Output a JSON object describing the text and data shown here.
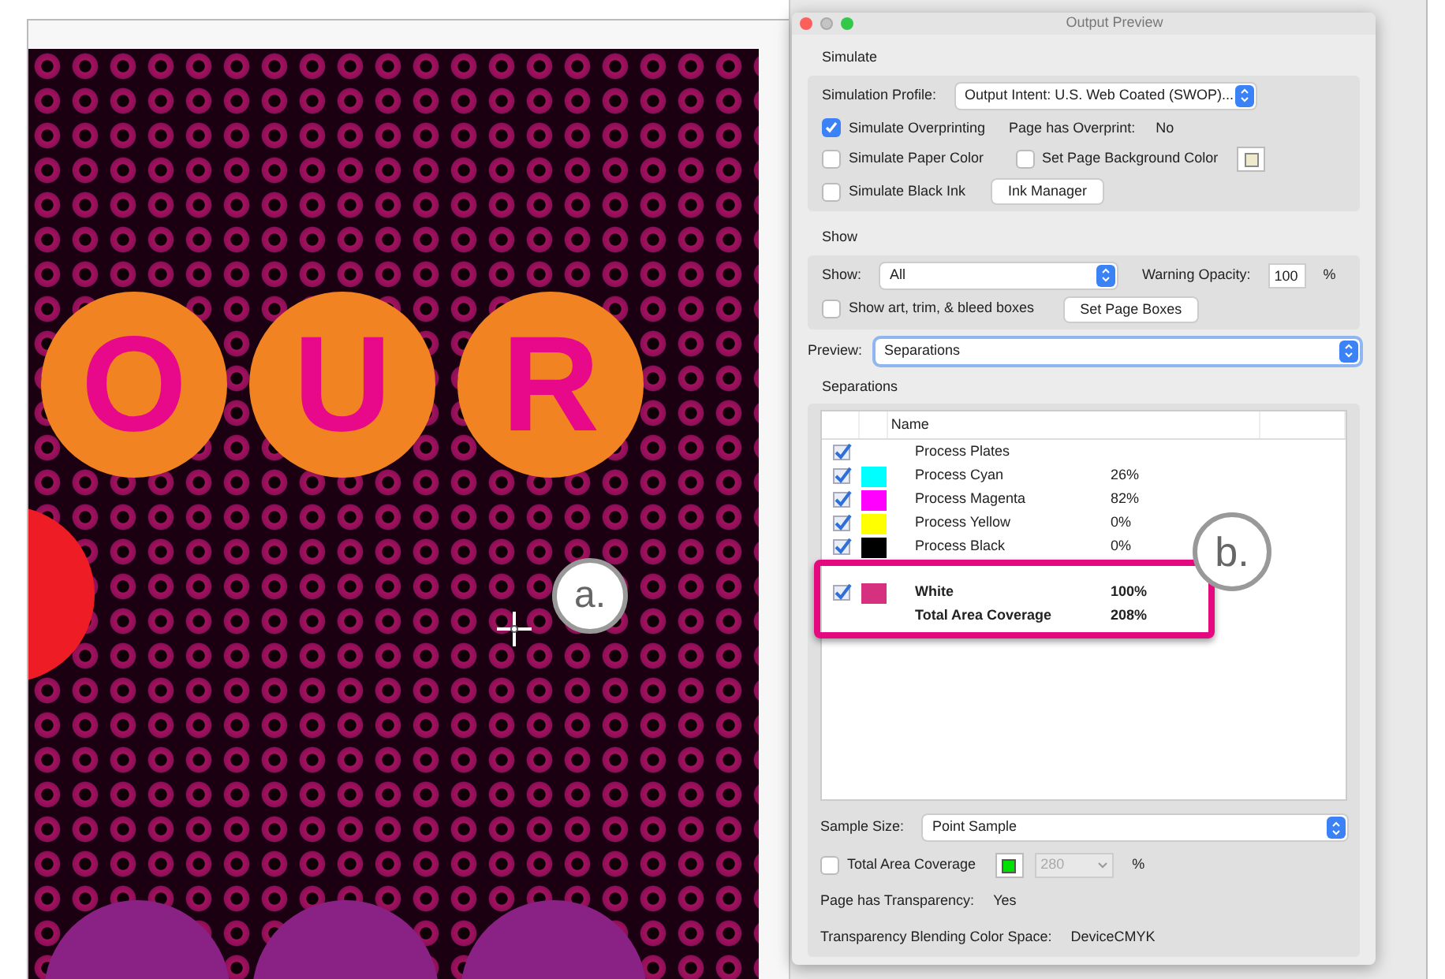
{
  "artwork": {
    "letters": [
      "O",
      "U",
      "R"
    ],
    "callouts": [
      {
        "label": "a."
      },
      {
        "label": "b."
      }
    ]
  },
  "window": {
    "title": "Output Preview"
  },
  "simulate": {
    "heading": "Simulate",
    "profile_label": "Simulation Profile:",
    "profile_value": "Output Intent: U.S. Web Coated (SWOP)...",
    "overprinting": {
      "label": "Simulate Overprinting",
      "checked": true
    },
    "overprint_label": "Page has Overprint:",
    "overprint_value": "No",
    "paper_color": {
      "label": "Simulate Paper Color",
      "checked": false
    },
    "background_color": {
      "label": "Set Page Background Color",
      "checked": false
    },
    "black_ink": {
      "label": "Simulate Black Ink",
      "checked": false
    },
    "ink_manager_button": "Ink Manager"
  },
  "show": {
    "heading": "Show",
    "show_label": "Show:",
    "show_value": "All",
    "opacity_label": "Warning Opacity:",
    "opacity_value": "100",
    "percent": "%",
    "boxes": {
      "label": "Show art, trim, & bleed boxes",
      "checked": false
    },
    "page_boxes_button": "Set Page Boxes"
  },
  "preview": {
    "label": "Preview:",
    "value": "Separations"
  },
  "separations": {
    "heading": "Separations",
    "column": "Name",
    "rows": [
      {
        "kind": "ink",
        "name": "Process Plates",
        "checked": true,
        "coverage": "",
        "highlighted": false
      },
      {
        "kind": "ink",
        "name": "Process Cyan",
        "checked": true,
        "color": "#00ffff",
        "coverage": "26%",
        "highlighted": false
      },
      {
        "kind": "ink",
        "name": "Process Magenta",
        "checked": true,
        "color": "#ff00ff",
        "coverage": "82%",
        "highlighted": false
      },
      {
        "kind": "ink",
        "name": "Process Yellow",
        "checked": true,
        "color": "#ffff00",
        "coverage": "0%",
        "highlighted": false
      },
      {
        "kind": "ink",
        "name": "Process Black",
        "checked": true,
        "color": "#000000",
        "coverage": "0%",
        "highlighted": false
      },
      {
        "kind": "ink",
        "name": "White",
        "checked": true,
        "color": "#d6317f",
        "coverage": "100%",
        "highlighted": true
      },
      {
        "kind": "total",
        "name": "Total Area Coverage",
        "coverage": "208%",
        "highlighted": true
      }
    ]
  },
  "sample_size": {
    "label": "Sample Size:",
    "value": "Point Sample"
  },
  "total_area_coverage": {
    "label": "Total Area Coverage",
    "checked": false,
    "value": "280",
    "disabled": true,
    "percent": "%"
  },
  "transparency": {
    "label": "Page has Transparency:",
    "value": "Yes"
  },
  "blending": {
    "label": "Transparency Blending Color Space:",
    "value": "DeviceCMYK"
  }
}
